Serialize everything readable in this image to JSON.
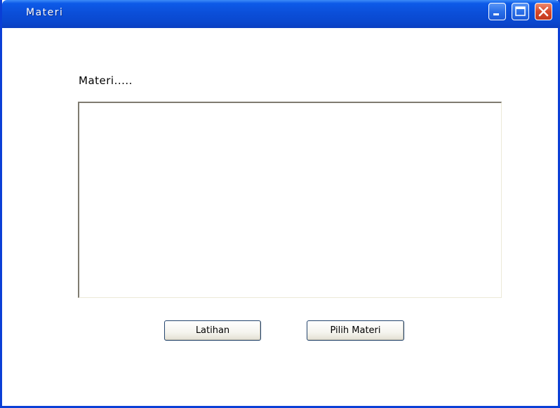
{
  "window": {
    "title": "Materi"
  },
  "content": {
    "label": "Materi.....",
    "textarea_value": ""
  },
  "buttons": {
    "latihan": "Latihan",
    "pilih_materi": "Pilih Materi"
  },
  "icons": {
    "minimize": "minimize-icon",
    "maximize": "maximize-icon",
    "close": "close-icon"
  },
  "colors": {
    "titlebar": "#0b4fd9",
    "close_button": "#d6482a",
    "window_border": "#0a3fd6"
  }
}
